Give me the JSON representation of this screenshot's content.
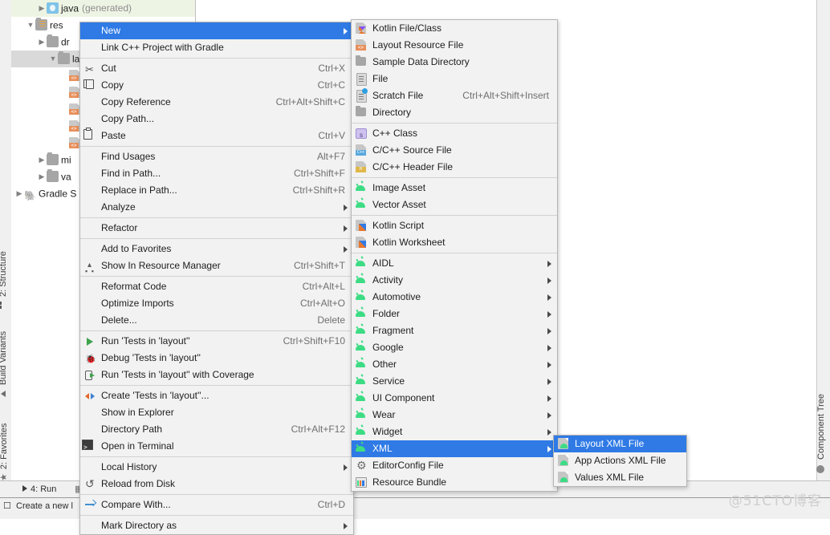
{
  "window": {
    "watermark": "@51CTO博客"
  },
  "left_tool_strip": {
    "items": [
      {
        "label": "2: Structure",
        "icon": "structure-icon"
      },
      {
        "label": "Build Variants",
        "icon": "build-variants-icon"
      },
      {
        "label": "2: Favorites",
        "icon": "star-icon"
      }
    ]
  },
  "right_tool_strip": {
    "items": [
      {
        "label": "Component Tree",
        "icon": "component-tree-icon"
      }
    ]
  },
  "project_tree": {
    "rows": [
      {
        "label": "java",
        "suffix": "(generated)",
        "icon": "java-folder-icon",
        "indent": 2,
        "twisty": "collapsed",
        "state": "tinted"
      },
      {
        "label": "res",
        "suffix": "",
        "icon": "res-folder-icon",
        "indent": 1,
        "twisty": "expanded",
        "state": "normal"
      },
      {
        "label": "dr",
        "suffix": "",
        "icon": "folder-icon",
        "indent": 2,
        "twisty": "collapsed",
        "state": "normal"
      },
      {
        "label": "la",
        "suffix": "",
        "icon": "folder-icon",
        "indent": 3,
        "twisty": "expanded",
        "state": "selected"
      },
      {
        "label": "",
        "suffix": "",
        "icon": "xml-file-icon",
        "indent": 4,
        "twisty": "none",
        "state": "normal"
      },
      {
        "label": "",
        "suffix": "",
        "icon": "xml-file-icon",
        "indent": 4,
        "twisty": "none",
        "state": "normal"
      },
      {
        "label": "",
        "suffix": "",
        "icon": "xml-file-icon",
        "indent": 4,
        "twisty": "none",
        "state": "normal"
      },
      {
        "label": "",
        "suffix": "",
        "icon": "xml-file-icon",
        "indent": 4,
        "twisty": "none",
        "state": "normal"
      },
      {
        "label": "",
        "suffix": "",
        "icon": "xml-file-icon",
        "indent": 4,
        "twisty": "none",
        "state": "normal"
      },
      {
        "label": "mi",
        "suffix": "",
        "icon": "folder-icon",
        "indent": 2,
        "twisty": "collapsed",
        "state": "normal"
      },
      {
        "label": "va",
        "suffix": "",
        "icon": "folder-icon",
        "indent": 2,
        "twisty": "collapsed",
        "state": "normal"
      },
      {
        "label": "Gradle S",
        "suffix": "",
        "icon": "gradle-icon",
        "indent": 0,
        "twisty": "collapsed",
        "state": "normal"
      }
    ]
  },
  "status_bar": {
    "run_tab": "4: Run",
    "message": "Create a new l"
  },
  "context_menu": {
    "items": [
      {
        "label": "New",
        "shortcut": "",
        "icon": "",
        "submenu": true,
        "highlighted": true
      },
      {
        "label": "Link C++ Project with Gradle",
        "shortcut": "",
        "icon": "",
        "submenu": false
      },
      {
        "separator": true
      },
      {
        "label": "Cut",
        "shortcut": "Ctrl+X",
        "icon": "scissors-icon",
        "submenu": false
      },
      {
        "label": "Copy",
        "shortcut": "Ctrl+C",
        "icon": "copy-icon",
        "submenu": false
      },
      {
        "label": "Copy Reference",
        "shortcut": "Ctrl+Alt+Shift+C",
        "icon": "",
        "submenu": false
      },
      {
        "label": "Copy Path...",
        "shortcut": "",
        "icon": "",
        "submenu": false
      },
      {
        "label": "Paste",
        "shortcut": "Ctrl+V",
        "icon": "paste-icon",
        "submenu": false
      },
      {
        "separator": true
      },
      {
        "label": "Find Usages",
        "shortcut": "Alt+F7",
        "icon": "",
        "submenu": false
      },
      {
        "label": "Find in Path...",
        "shortcut": "Ctrl+Shift+F",
        "icon": "",
        "submenu": false
      },
      {
        "label": "Replace in Path...",
        "shortcut": "Ctrl+Shift+R",
        "icon": "",
        "submenu": false
      },
      {
        "label": "Analyze",
        "shortcut": "",
        "icon": "",
        "submenu": true
      },
      {
        "separator": true
      },
      {
        "label": "Refactor",
        "shortcut": "",
        "icon": "",
        "submenu": true
      },
      {
        "separator": true
      },
      {
        "label": "Add to Favorites",
        "shortcut": "",
        "icon": "",
        "submenu": true
      },
      {
        "label": "Show In Resource Manager",
        "shortcut": "Ctrl+Shift+T",
        "icon": "resource-manager-icon",
        "submenu": false
      },
      {
        "separator": true
      },
      {
        "label": "Reformat Code",
        "shortcut": "Ctrl+Alt+L",
        "icon": "",
        "submenu": false
      },
      {
        "label": "Optimize Imports",
        "shortcut": "Ctrl+Alt+O",
        "icon": "",
        "submenu": false
      },
      {
        "label": "Delete...",
        "shortcut": "Delete",
        "icon": "",
        "submenu": false
      },
      {
        "separator": true
      },
      {
        "label": "Run 'Tests in 'layout''",
        "shortcut": "Ctrl+Shift+F10",
        "icon": "run-icon",
        "submenu": false
      },
      {
        "label": "Debug 'Tests in 'layout''",
        "shortcut": "",
        "icon": "debug-icon",
        "submenu": false
      },
      {
        "label": "Run 'Tests in 'layout'' with Coverage",
        "shortcut": "",
        "icon": "coverage-icon",
        "submenu": false
      },
      {
        "separator": true
      },
      {
        "label": "Create 'Tests in 'layout''...",
        "shortcut": "",
        "icon": "create-config-icon",
        "submenu": false
      },
      {
        "label": "Show in Explorer",
        "shortcut": "",
        "icon": "",
        "submenu": false
      },
      {
        "label": "Directory Path",
        "shortcut": "Ctrl+Alt+F12",
        "icon": "",
        "submenu": false
      },
      {
        "label": "Open in Terminal",
        "shortcut": "",
        "icon": "terminal-icon",
        "submenu": false
      },
      {
        "separator": true
      },
      {
        "label": "Local History",
        "shortcut": "",
        "icon": "",
        "submenu": true
      },
      {
        "label": "Reload from Disk",
        "shortcut": "",
        "icon": "reload-icon",
        "submenu": false
      },
      {
        "separator": true
      },
      {
        "label": "Compare With...",
        "shortcut": "Ctrl+D",
        "icon": "compare-icon",
        "submenu": false
      },
      {
        "separator": true
      },
      {
        "label": "Mark Directory as",
        "shortcut": "",
        "icon": "",
        "submenu": true
      }
    ]
  },
  "new_submenu": {
    "items": [
      {
        "label": "Kotlin File/Class",
        "shortcut": "",
        "icon": "kotlin-file-icon",
        "submenu": false
      },
      {
        "label": "Layout Resource File",
        "shortcut": "",
        "icon": "layout-xml-icon",
        "submenu": false
      },
      {
        "label": "Sample Data Directory",
        "shortcut": "",
        "icon": "directory-icon",
        "submenu": false
      },
      {
        "label": "File",
        "shortcut": "",
        "icon": "file-icon",
        "submenu": false
      },
      {
        "label": "Scratch File",
        "shortcut": "Ctrl+Alt+Shift+Insert",
        "icon": "scratch-file-icon",
        "submenu": false
      },
      {
        "label": "Directory",
        "shortcut": "",
        "icon": "directory-icon",
        "submenu": false
      },
      {
        "separator": true
      },
      {
        "label": "C++ Class",
        "shortcut": "",
        "icon": "cpp-class-icon",
        "submenu": false
      },
      {
        "label": "C/C++ Source File",
        "shortcut": "",
        "icon": "cpp-source-icon",
        "submenu": false
      },
      {
        "label": "C/C++ Header File",
        "shortcut": "",
        "icon": "cpp-header-icon",
        "submenu": false
      },
      {
        "separator": true
      },
      {
        "label": "Image Asset",
        "shortcut": "",
        "icon": "android-icon",
        "submenu": false
      },
      {
        "label": "Vector Asset",
        "shortcut": "",
        "icon": "android-icon",
        "submenu": false
      },
      {
        "separator": true
      },
      {
        "label": "Kotlin Script",
        "shortcut": "",
        "icon": "kotlin-script-icon",
        "submenu": false
      },
      {
        "label": "Kotlin Worksheet",
        "shortcut": "",
        "icon": "kotlin-script-icon",
        "submenu": false
      },
      {
        "separator": true
      },
      {
        "label": "AIDL",
        "shortcut": "",
        "icon": "android-icon",
        "submenu": true
      },
      {
        "label": "Activity",
        "shortcut": "",
        "icon": "android-icon",
        "submenu": true
      },
      {
        "label": "Automotive",
        "shortcut": "",
        "icon": "android-icon",
        "submenu": true
      },
      {
        "label": "Folder",
        "shortcut": "",
        "icon": "android-icon",
        "submenu": true
      },
      {
        "label": "Fragment",
        "shortcut": "",
        "icon": "android-icon",
        "submenu": true
      },
      {
        "label": "Google",
        "shortcut": "",
        "icon": "android-icon",
        "submenu": true
      },
      {
        "label": "Other",
        "shortcut": "",
        "icon": "android-icon",
        "submenu": true
      },
      {
        "label": "Service",
        "shortcut": "",
        "icon": "android-icon",
        "submenu": true
      },
      {
        "label": "UI Component",
        "shortcut": "",
        "icon": "android-icon",
        "submenu": true
      },
      {
        "label": "Wear",
        "shortcut": "",
        "icon": "android-icon",
        "submenu": true
      },
      {
        "label": "Widget",
        "shortcut": "",
        "icon": "android-icon",
        "submenu": true
      },
      {
        "label": "XML",
        "shortcut": "",
        "icon": "android-icon",
        "submenu": true,
        "highlighted": true
      },
      {
        "label": "EditorConfig File",
        "shortcut": "",
        "icon": "gear-icon",
        "submenu": false
      },
      {
        "label": "Resource Bundle",
        "shortcut": "",
        "icon": "resource-bundle-icon",
        "submenu": false
      }
    ]
  },
  "xml_submenu": {
    "items": [
      {
        "label": "Layout XML File",
        "shortcut": "",
        "icon": "xml-file-icon",
        "submenu": false,
        "highlighted": true
      },
      {
        "label": "App Actions XML File",
        "shortcut": "",
        "icon": "xml-file-icon",
        "submenu": false
      },
      {
        "label": "Values XML File",
        "shortcut": "",
        "icon": "xml-file-icon",
        "submenu": false
      }
    ]
  }
}
